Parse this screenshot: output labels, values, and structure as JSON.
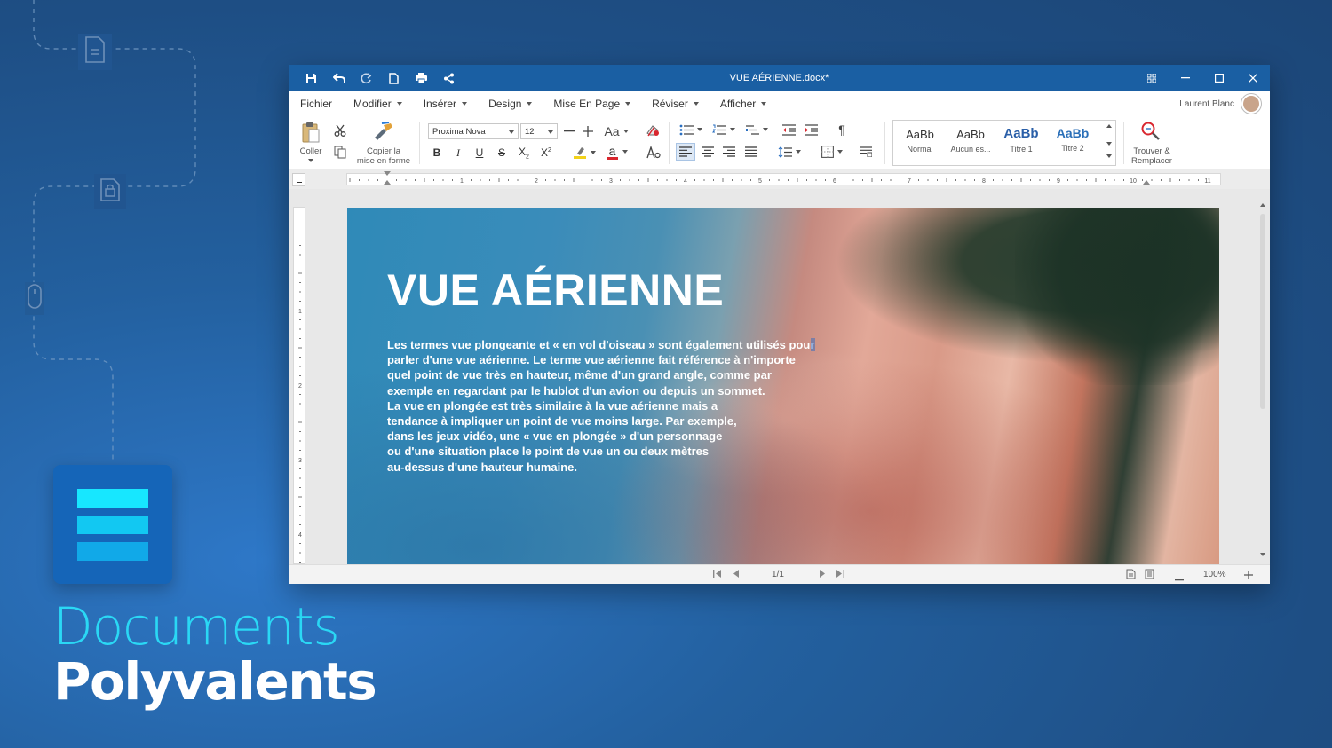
{
  "brand": {
    "line1": "Documents",
    "line2": "Polyvalents",
    "logo_colors": [
      "#17e7ff",
      "#12c8f2",
      "#11a9e8"
    ]
  },
  "window": {
    "title": "VUE AÉRIENNE.docx*",
    "controls": [
      "restore-layout-icon",
      "minimize-icon",
      "maximize-icon",
      "close-icon"
    ]
  },
  "quick_access": [
    "save-icon",
    "undo-icon",
    "redo-icon",
    "new-document-icon",
    "print-icon",
    "share-icon"
  ],
  "menu": {
    "items": [
      "Fichier",
      "Modifier",
      "Insérer",
      "Design",
      "Mise En Page",
      "Réviser",
      "Afficher"
    ],
    "user_name": "Laurent Blanc"
  },
  "ribbon": {
    "paste_label": "Coller",
    "format_painter_label_1": "Copier la",
    "format_painter_label_2": "mise en forme",
    "font_name": "Proxima Nova",
    "font_size": "12",
    "case_label": "Aa",
    "font_color_letter": "a",
    "highlight_color": "#f2d21a",
    "font_color": "#d9262e",
    "styles": [
      {
        "sample": "AaBb",
        "name": "Normal",
        "color": "#333333",
        "bold": false
      },
      {
        "sample": "AaBb",
        "name": "Aucun es...",
        "color": "#333333",
        "bold": false
      },
      {
        "sample": "AaBb",
        "name": "Titre 1",
        "color": "#2a5fa8",
        "bold": true
      },
      {
        "sample": "AaBb",
        "name": "Titre 2",
        "color": "#2a6fb8",
        "bold": true
      }
    ],
    "find_label_1": "Trouver &",
    "find_label_2": "Remplacer"
  },
  "ruler": {
    "numbers": [
      "1",
      "2",
      "3",
      "4",
      "5",
      "6",
      "7",
      "8",
      "9",
      "10",
      "11"
    ],
    "vnumbers": [
      "1",
      "2",
      "3",
      "4"
    ]
  },
  "document": {
    "heading": "VUE AÉRIENNE",
    "body_lines": [
      "Les termes vue plongeante et « en vol d'oiseau » sont également utilisés pour",
      "parler d'une vue aérienne. Le terme vue aérienne fait référence à n'importe",
      "quel point de vue très en hauteur, même d'un grand angle, comme par",
      "exemple en regardant par le hublot d'un avion ou depuis un sommet.",
      "La vue en plongée est très similaire à la vue aérienne mais a",
      "tendance à impliquer un point de vue moins large. Par exemple,",
      "dans les jeux vidéo, une « vue en plongée » d'un personnage",
      "ou d'une situation place le point de vue un ou deux mètres",
      "au-dessus d'une hauteur humaine."
    ]
  },
  "status": {
    "page": "1/1",
    "zoom": "100%"
  }
}
